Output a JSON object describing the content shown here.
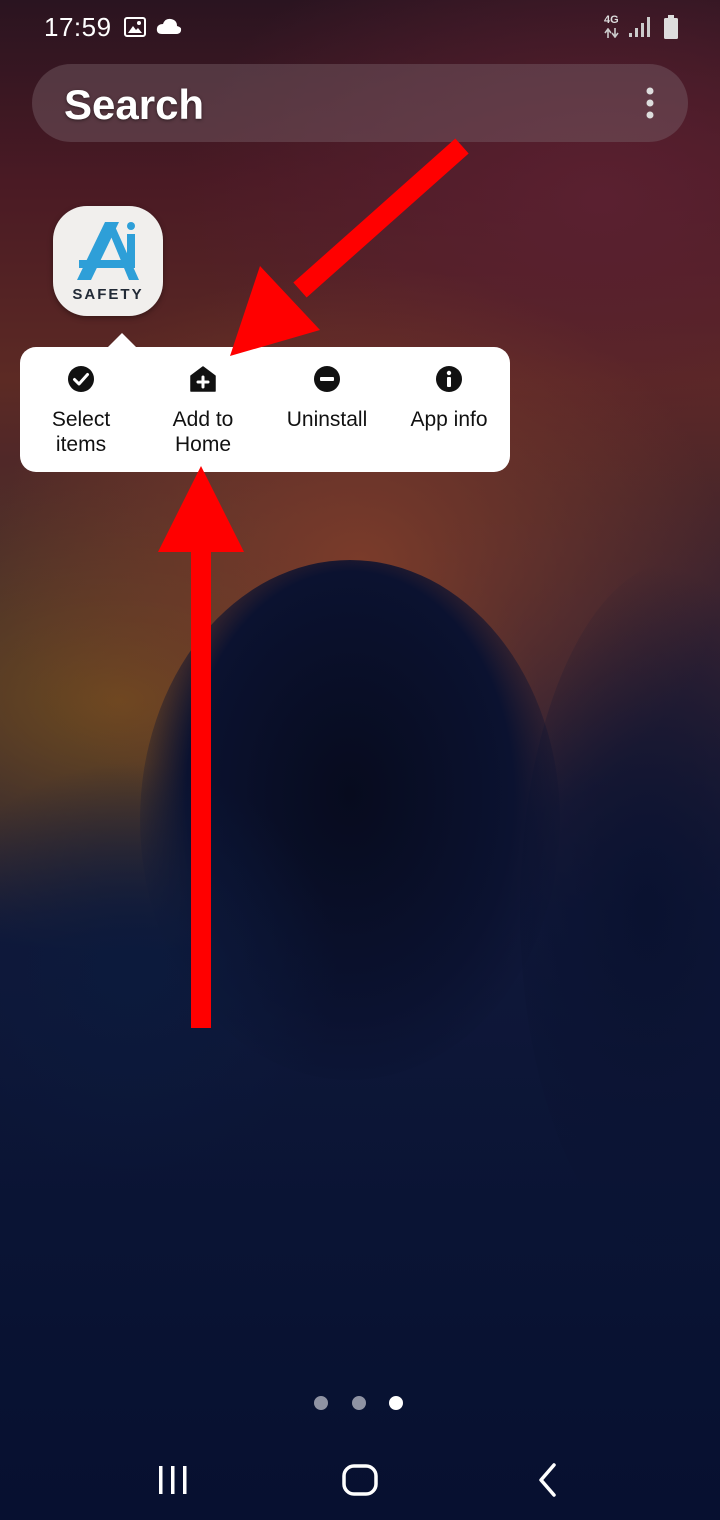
{
  "status_bar": {
    "time": "17:59",
    "network": "4G",
    "icons": [
      "gallery-icon",
      "cloud-icon",
      "data-arrows-icon",
      "signal-icon",
      "battery-icon"
    ]
  },
  "search": {
    "label": "Search",
    "menu_icon": "more-options-icon"
  },
  "app": {
    "icon_text": "SAFETY",
    "logo_mark": "AI",
    "logo_color": "#2e9fd8"
  },
  "context_menu": {
    "items": [
      {
        "label": "Select\nitems",
        "icon": "check-circle-icon"
      },
      {
        "label": "Add to\nHome",
        "icon": "home-add-icon"
      },
      {
        "label": "Uninstall",
        "icon": "minus-circle-icon"
      },
      {
        "label": "App info",
        "icon": "info-circle-icon"
      }
    ]
  },
  "annotation": {
    "arrow_color": "#ff0000"
  },
  "page_indicator": {
    "count": 3,
    "active_index": 2
  },
  "nav_bar": {
    "buttons": [
      "recents-button",
      "home-button",
      "back-button"
    ]
  }
}
